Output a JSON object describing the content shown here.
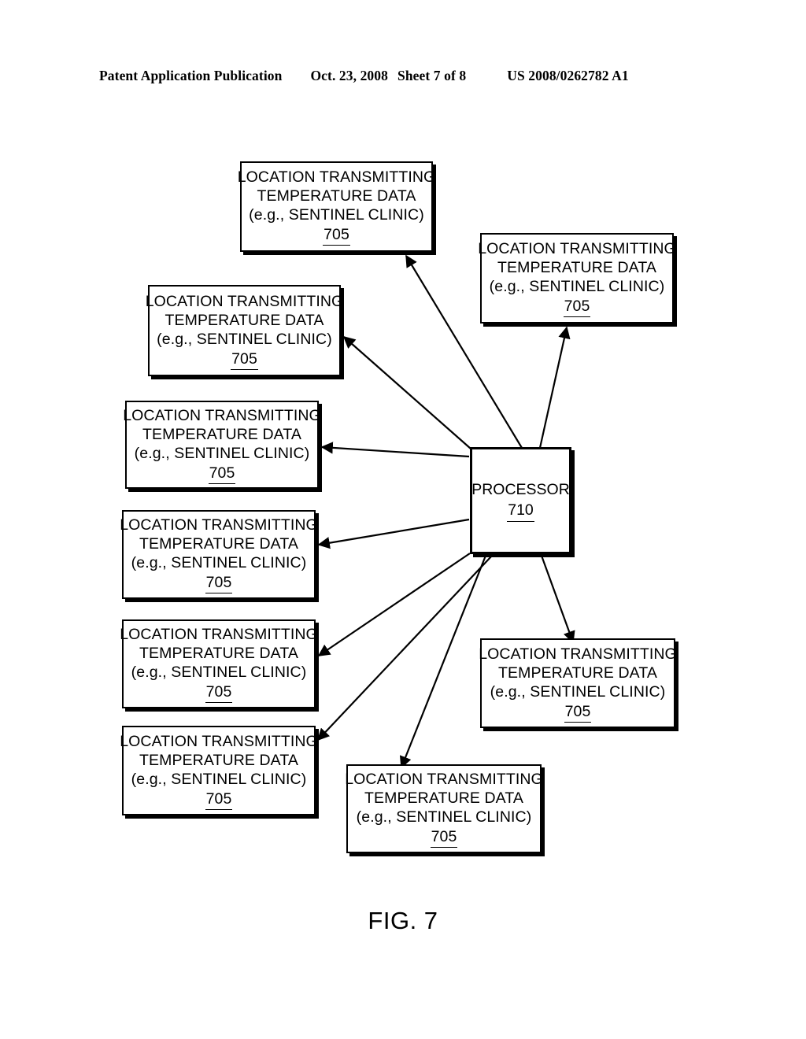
{
  "header": {
    "publication": "Patent Application Publication",
    "date": "Oct. 23, 2008",
    "sheet": "Sheet 7 of 8",
    "patent_number": "US 2008/0262782 A1"
  },
  "figure": {
    "caption": "FIG. 7",
    "processor": {
      "label": "PROCESSOR",
      "ref": "710"
    },
    "node_text": {
      "line1": "LOCATION TRANSMITTING",
      "line2": "TEMPERATURE DATA",
      "line3": "(e.g., SENTINEL CLINIC)",
      "ref": "705"
    },
    "nodes": [
      {
        "id": "node-1",
        "position": "top-center"
      },
      {
        "id": "node-2",
        "position": "upper-left"
      },
      {
        "id": "node-3",
        "position": "top-right"
      },
      {
        "id": "node-4",
        "position": "left-upper"
      },
      {
        "id": "node-5",
        "position": "left-middle"
      },
      {
        "id": "node-6",
        "position": "left-lower"
      },
      {
        "id": "node-7",
        "position": "bottom-left"
      },
      {
        "id": "node-8",
        "position": "bottom-right"
      },
      {
        "id": "node-9",
        "position": "bottom-center"
      }
    ],
    "connections": [
      {
        "from": "processor",
        "to": "node-1"
      },
      {
        "from": "processor",
        "to": "node-2"
      },
      {
        "from": "processor",
        "to": "node-3"
      },
      {
        "from": "processor",
        "to": "node-4"
      },
      {
        "from": "processor",
        "to": "node-5"
      },
      {
        "from": "processor",
        "to": "node-6"
      },
      {
        "from": "processor",
        "to": "node-7"
      },
      {
        "from": "processor",
        "to": "node-8"
      },
      {
        "from": "processor",
        "to": "node-9"
      }
    ],
    "colors": {
      "stroke": "#000000",
      "background": "#ffffff"
    }
  }
}
